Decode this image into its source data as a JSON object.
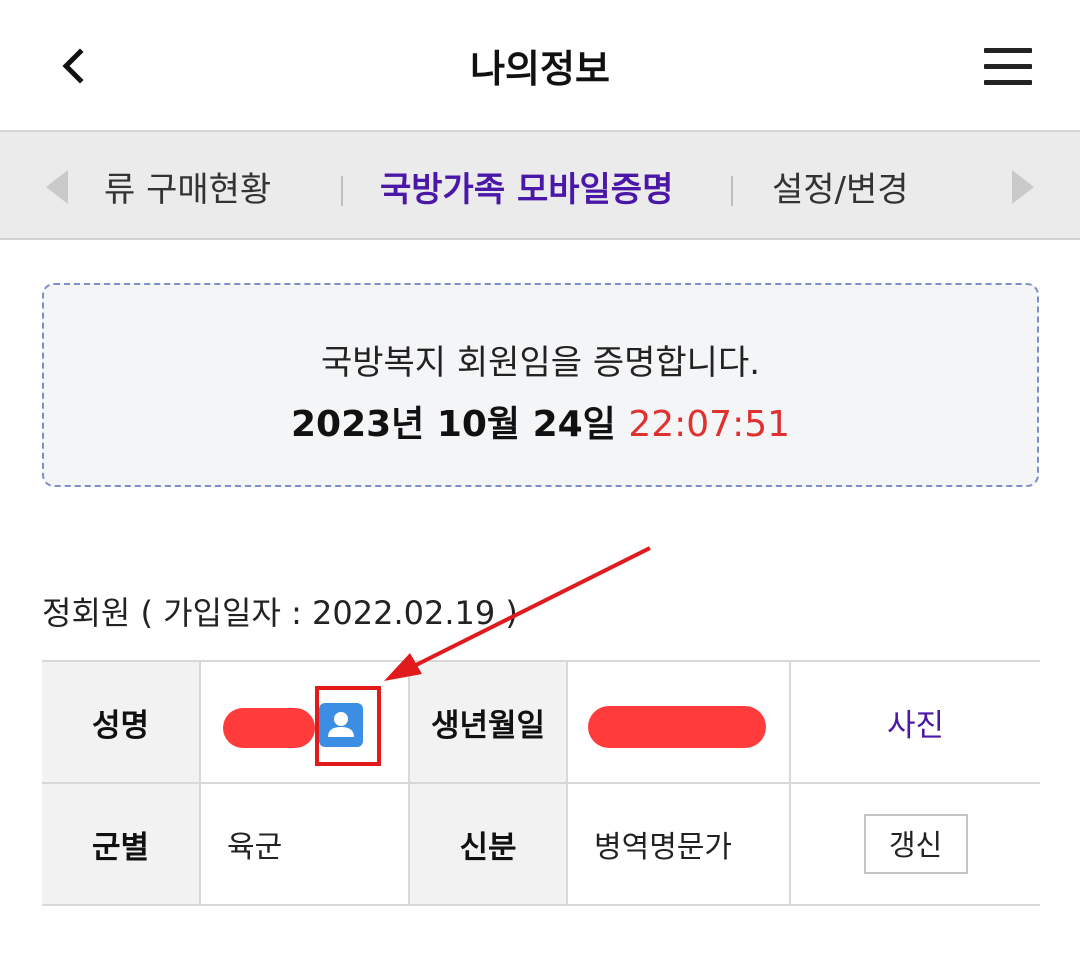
{
  "header": {
    "title": "나의정보",
    "back_icon": "chevron-left-icon",
    "menu_icon": "hamburger-menu-icon"
  },
  "tabs": {
    "items": [
      {
        "label": "류 구매현황",
        "active": false
      },
      {
        "label": "국방가족 모바일증명",
        "active": true
      },
      {
        "label": "설정/변경",
        "active": false
      }
    ],
    "active_color": "#4a17a8"
  },
  "certificate": {
    "statement": "국방복지 회원임을 증명합니다.",
    "date": "2023년 10월 24일",
    "time": "22:07:51",
    "time_color": "#e03030"
  },
  "membership": {
    "text": "정회원 ( 가입일자 : 2022.02.19 )"
  },
  "info_table": {
    "name_label": "성명",
    "birth_label": "생년월일",
    "photo_label": "사진",
    "branch_label": "군별",
    "branch_value": "육군",
    "status_label": "신분",
    "status_value": "병역명문가",
    "renew_label": "갱신"
  },
  "annotation": {
    "box_color": "#e11b1b",
    "arrow_color": "#e11b1b",
    "redaction_color": "#ff3b3b"
  }
}
